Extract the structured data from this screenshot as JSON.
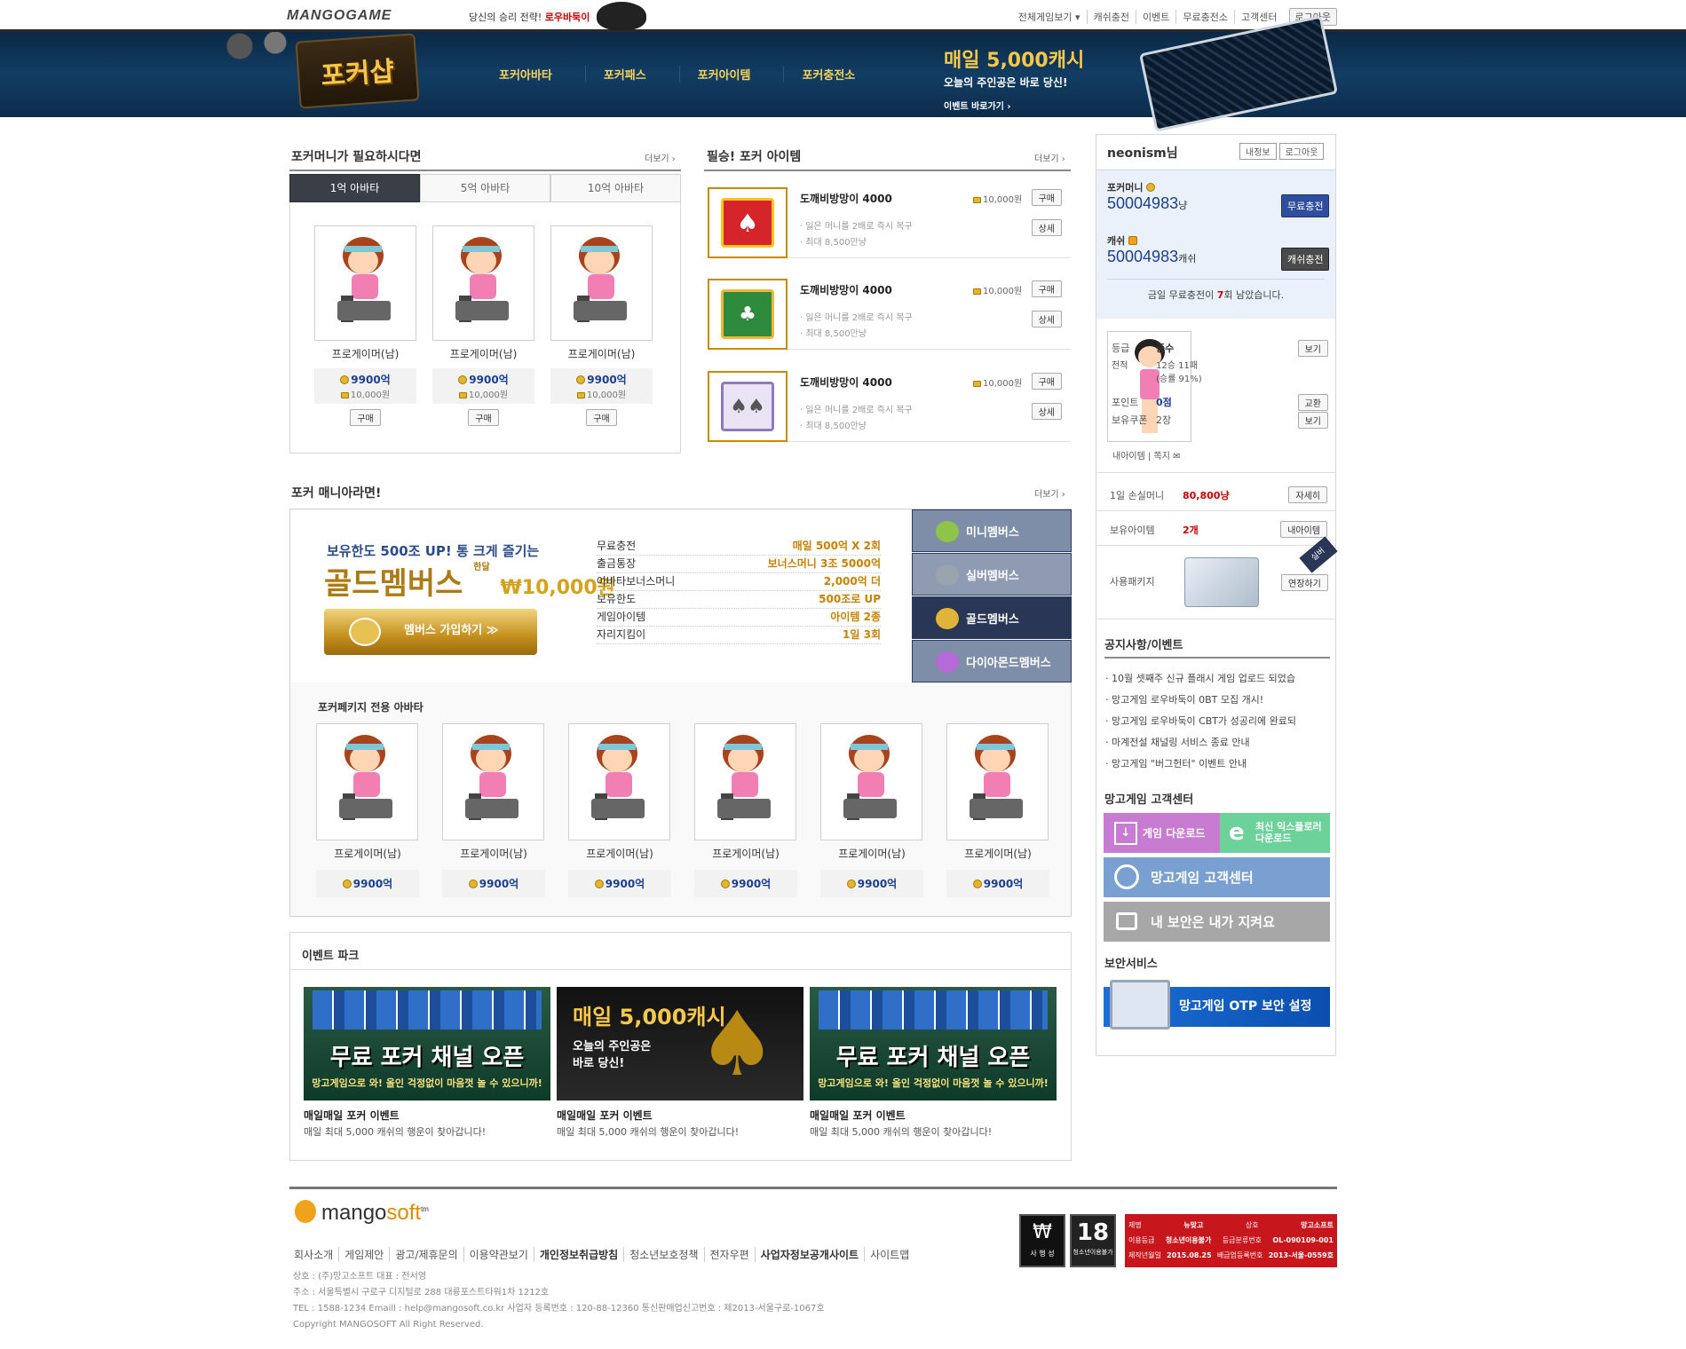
{
  "topbar": {
    "logo": "MANGOGAME",
    "slogan_prefix": "당신의 승리 전략!",
    "slogan_link": "로우바둑이",
    "nav": [
      "전체게임보기",
      "캐쉬충전",
      "이벤트",
      "무료충전소",
      "고객센터"
    ],
    "logout": "로그아웃"
  },
  "banner": {
    "shop_logo": "포커샵",
    "nav": [
      "포커아바타",
      "포커패스",
      "포커아이템",
      "포커충전소"
    ],
    "promo_title": "매일 5,000캐시",
    "promo_sub": "오늘의 주인공은 바로 당신!",
    "promo_link": "이벤트 바로가기 ›"
  },
  "poker_money": {
    "title": "포커머니가 필요하시다면",
    "more": "더보기 ›",
    "tabs": [
      "1억 아바타",
      "5억 아바타",
      "10억 아바타"
    ],
    "active_tab": 0,
    "avatars": [
      {
        "name": "프로게이머(남)",
        "price": "9900억",
        "won": "10,000원",
        "buy": "구매"
      },
      {
        "name": "프로게이머(남)",
        "price": "9900억",
        "won": "10,000원",
        "buy": "구매"
      },
      {
        "name": "프로게이머(남)",
        "price": "9900억",
        "won": "10,000원",
        "buy": "구매"
      }
    ]
  },
  "items": {
    "title": "필승! 포커 아이템",
    "more": "더보기 ›",
    "list": [
      {
        "name": "도깨비방망이 4000",
        "price": "10,000원",
        "buy": "구매",
        "detail": "상세",
        "desc1": "· 잃은 머니를 2배로 즉시 복구",
        "desc2": "· 최대 8,500만냥",
        "colors": [
          "#d6242b",
          "#f7c61d"
        ]
      },
      {
        "name": "도깨비방망이 4000",
        "price": "10,000원",
        "buy": "구매",
        "detail": "상세",
        "desc1": "· 잃은 머니를 2배로 즉시 복구",
        "desc2": "· 최대 8,500만냥",
        "colors": [
          "#2e8a3c",
          "#f0b63a"
        ]
      },
      {
        "name": "도깨비방망이 4000",
        "price": "10,000원",
        "buy": "구매",
        "detail": "상세",
        "desc1": "· 잃은 머니를 2배로 즉시 복구",
        "desc2": "· 최대 8,500만냥",
        "colors": [
          "#8c7bc0",
          "#e8e3f5"
        ]
      }
    ]
  },
  "mania": {
    "title": "포커 매니아라면!",
    "more": "더보기 ›",
    "headline": "보유한도 500조 UP! 통 크게 즐기는",
    "membership": "골드멤버스",
    "monthly": "한달",
    "price": "₩10,000원",
    "join_button": "멤버스 가입하기 ≫",
    "benefits": [
      {
        "label": "무료충전",
        "value": "매일 500억 X 2회"
      },
      {
        "label": "출금통장",
        "value": "보너스머니 3조 5000억"
      },
      {
        "label": "아바타보너스머니",
        "value": "2,000억 더"
      },
      {
        "label": "보유한도",
        "value": "500조로 UP"
      },
      {
        "label": "게임아이템",
        "value": "아이템 2종"
      },
      {
        "label": "자리지킴이",
        "value": "1일 3회"
      }
    ],
    "member_tabs": [
      {
        "label": "미니멤버스",
        "icon": "M",
        "bg": "#7f8ea8",
        "ic": "#8fc44a"
      },
      {
        "label": "실버멤버스",
        "icon": "S",
        "bg": "#8e9bb3",
        "ic": "#9aa4ad"
      },
      {
        "label": "골드멤버스",
        "icon": "G",
        "bg": "#2a3656",
        "ic": "#e1b437"
      },
      {
        "label": "다이아몬드멤버스",
        "icon": "D",
        "bg": "#7f8ea8",
        "ic": "#b56ad8"
      }
    ],
    "package_title": "포커페키지 전용 아바타",
    "package_avatars": [
      {
        "name": "프로게이머(남)",
        "price": "9900억"
      },
      {
        "name": "프로게이머(남)",
        "price": "9900억"
      },
      {
        "name": "프로게이머(남)",
        "price": "9900억"
      },
      {
        "name": "프로게이머(남)",
        "price": "9900억"
      },
      {
        "name": "프로게이머(남)",
        "price": "9900억"
      },
      {
        "name": "프로게이머(남)",
        "price": "9900억"
      }
    ]
  },
  "event_park": {
    "title": "이벤트 파크",
    "cards": [
      {
        "headline": "무료 포커 채널 오픈",
        "sub": "망고게임으로 와! 올인 걱정없이 마음껏 놀 수 있으니까!",
        "name": "매일매일 포커 이벤트",
        "desc": "매일 최대 5,000 캐쉬의 행운이 찾아갑니다!",
        "style": "green"
      },
      {
        "headline": "매일 5,000캐시",
        "sub": "오늘의 주인공은 바로 당신!",
        "name": "매일매일 포커 이벤트",
        "desc": "매일 최대 5,000 캐쉬의 행운이 찾아갑니다!",
        "style": "dark"
      },
      {
        "headline": "무료 포커 채널 오픈",
        "sub": "망고게임으로 와! 올인 걱정없이 마음껏 놀 수 있으니까!",
        "name": "매일매일 포커 이벤트",
        "desc": "매일 최대 5,000 캐쉬의 행운이 찾아갑니다!",
        "style": "green"
      }
    ]
  },
  "user": {
    "name": "neonism님",
    "my_info": "내정보",
    "logout": "로그아웃",
    "poker_money_label": "포커머니",
    "poker_money": "50004983",
    "poker_money_unit": "냥",
    "free_charge": "무료충전",
    "cash_label": "캐쉬",
    "cash": "50004983",
    "cash_unit": "캐쉬",
    "cash_charge": "캐쉬충전",
    "free_left_prefix": "금일 무료충전이 ",
    "free_left_count": "7",
    "free_left_suffix": "회 남았습니다.",
    "grade_label": "등급",
    "grade": "중수",
    "view": "보기",
    "record_label": "전적",
    "record": "12승 11패",
    "record_rate": "(승률 91%)",
    "point_label": "포인트",
    "point": "0점",
    "exchange": "교환",
    "coupon_label": "보유쿠폰",
    "coupon": "2장",
    "my_items": "내아이템",
    "memo": "쪽지",
    "daily_loss_label": "1일 손실머니",
    "daily_loss": "80,800냥",
    "detail": "자세히",
    "items_label": "보유아이템",
    "items_count": "2개",
    "my_items_btn": "내아이템",
    "package_label": "사용패키지",
    "package_badge": "실버",
    "extend": "연장하기"
  },
  "notices": {
    "title": "공지사항/이벤트",
    "list": [
      "· 10월 셋째주 신규 플래시 게임 업로드 되었습",
      "· 망고게임 로우바둑이 0BT 모집 개시!",
      "· 망고게임 로우바둑이 CBT가 성공리에 완료되",
      "· 마계전설 채널링 서비스 종료 안내",
      "· 망고게임 \"버그헌터\" 이벤트 안내"
    ]
  },
  "cs": {
    "title": "망고게임 고객센터",
    "download": "게임 다운로드",
    "explorer_1": "최신 익스플로러",
    "explorer_2": "다운로드",
    "center": "망고게임 고객센터",
    "security": "내 보안은 내가 지켜요",
    "security_title": "보안서비스",
    "otp": "망고게임 OTP 보안 설정"
  },
  "footer": {
    "logo_a": "mango",
    "logo_b": "soft",
    "tm": "tm",
    "links": [
      "회사소개",
      "게임제안",
      "광고/제휴문의",
      "이용약관보기",
      "개인정보취급방침",
      "청소년보호정책",
      "전자우편",
      "사업자정보공개사이트",
      "사이트맵"
    ],
    "bold_links": [
      4,
      7
    ],
    "info": [
      "상호 : (주)망고소프트 대표 : 전서영",
      "주소 : 서울특별시 구로구 디지털로 288 대륭포스트타워1차 1212호",
      "TEL : 1588-1234 Emaill : help@mangosoft.co.kr 사업자 등록번호 : 120-88-12360 통신판매업신고번호 : 제2013-서울구로-1067호",
      "Copyright MANGOSOFT All Right Reserved."
    ],
    "rating1": "사 행 성",
    "rating2": "청소년이용불가",
    "rating_table": [
      [
        "제명",
        "뉴맞고",
        "상호",
        "망고소프트"
      ],
      [
        "이용등급",
        "청소년이용불가",
        "등급분류번호",
        "OL-090109-001"
      ],
      [
        "제작년월일",
        "2015.08.25",
        "배급업등록번호",
        "2013-서울-0559호"
      ]
    ]
  }
}
